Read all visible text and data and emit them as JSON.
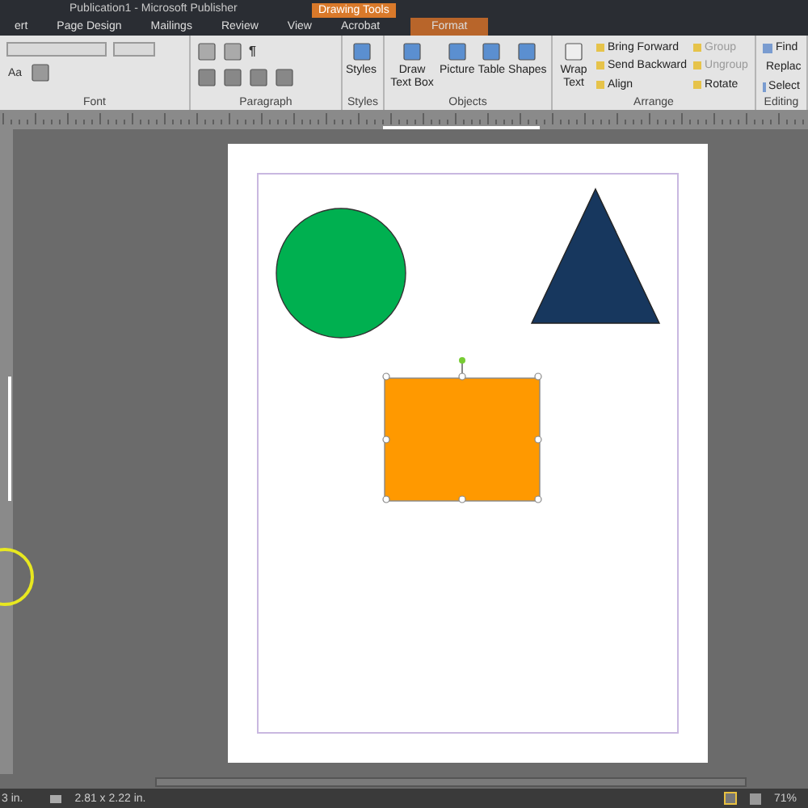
{
  "window": {
    "title": "Publication1 - Microsoft Publisher",
    "contextual_group": "Drawing Tools"
  },
  "tabs": [
    {
      "label": "ert",
      "contextual": false
    },
    {
      "label": "Page Design",
      "contextual": false
    },
    {
      "label": "Mailings",
      "contextual": false
    },
    {
      "label": "Review",
      "contextual": false
    },
    {
      "label": "View",
      "contextual": false
    },
    {
      "label": "Acrobat",
      "contextual": false
    },
    {
      "label": "Format",
      "contextual": true
    }
  ],
  "ribbon": {
    "groups": [
      {
        "label": "Font",
        "kind": "font",
        "buttons": [
          "Aa"
        ]
      },
      {
        "label": "Paragraph",
        "kind": "paragraph",
        "buttons": [
          "¶"
        ]
      },
      {
        "label": "Styles",
        "kind": "large",
        "buttons": [
          "Styles"
        ]
      },
      {
        "label": "Objects",
        "kind": "large",
        "buttons": [
          "Draw Text Box",
          "Picture",
          "Table",
          "Shapes"
        ]
      },
      {
        "label": "Arrange",
        "kind": "arrange",
        "buttons": [
          "Wrap Text",
          "Bring Forward",
          "Send Backward",
          "Align",
          "Group",
          "Ungroup",
          "Rotate"
        ]
      },
      {
        "label": "Editing",
        "kind": "small",
        "buttons": [
          "Find",
          "Replac",
          "Select"
        ]
      }
    ]
  },
  "shapes": [
    {
      "kind": "circle",
      "color": "#00b050",
      "selected": false
    },
    {
      "kind": "triangle",
      "color": "#17375e",
      "selected": false
    },
    {
      "kind": "rectangle",
      "color": "#ff9900",
      "selected": true
    }
  ],
  "status_bar": {
    "position": "3 in.",
    "size": "2.81 x 2.22 in.",
    "zoom": "71%"
  }
}
